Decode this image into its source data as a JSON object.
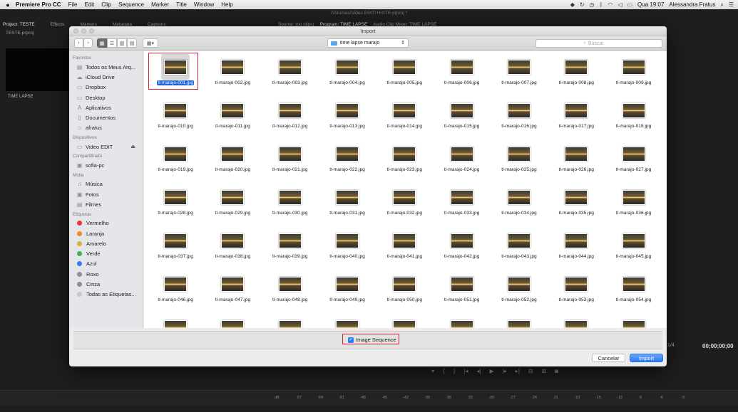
{
  "menubar": {
    "apple": "",
    "app_name": "Premiere Pro CC",
    "items": [
      "File",
      "Edit",
      "Clip",
      "Sequence",
      "Marker",
      "Title",
      "Window",
      "Help"
    ],
    "day_time": "Qua 19:07",
    "user": "Alessandra Fratus"
  },
  "premiere": {
    "path_title": "/Volumes/Video EDIT/TESTE.prproj *",
    "tabs_left": [
      "Project: TESTE",
      "Effects",
      "Markers",
      "Metadata",
      "Captions"
    ],
    "project_file": "TESTE.prproj",
    "clip_label": "TIME LAPSE",
    "source_tab": "Source: (no clips)",
    "program_tab": "Program: TIME LAPSE",
    "mixer_tab": "Audio Clip Mixer: TIME LAPSE",
    "timecode": "00;00;00;00",
    "timecode_left": "1/4",
    "ruler": [
      "-57",
      "-54",
      "-51",
      "-48",
      "-45",
      "-42",
      "-39",
      "-36",
      "-33",
      "-30",
      "-27",
      "-24",
      "-21",
      "-18",
      "-15",
      "-12",
      "-9",
      "-6",
      "-3",
      "dB"
    ]
  },
  "dialog": {
    "title": "Import",
    "location": "time lapse marajo",
    "search_placeholder": "Buscar",
    "sidebar": {
      "favorites_header": "Favoritos",
      "favorites": [
        "Todos os Meus Arq...",
        "iCloud Drive",
        "Dropbox",
        "Desktop",
        "Aplicativos",
        "Documentos",
        "afratus"
      ],
      "devices_header": "Dispositivos",
      "devices": [
        "Video EDIT"
      ],
      "shared_header": "Compartilhado",
      "shared": [
        "sofia-pc"
      ],
      "media_header": "Mídia",
      "media": [
        "Música",
        "Fotos",
        "Filmes"
      ],
      "tags_header": "Etiquetas",
      "tags": [
        {
          "label": "Vermelho",
          "color": "#f2343a"
        },
        {
          "label": "Laranja",
          "color": "#e8892b"
        },
        {
          "label": "Amarelo",
          "color": "#d7b13a"
        },
        {
          "label": "Verde",
          "color": "#3cb54a"
        },
        {
          "label": "Azul",
          "color": "#3478f6"
        },
        {
          "label": "Roxo",
          "color": "#9b87aa"
        },
        {
          "label": "Cinza",
          "color": "#8e8e93"
        },
        {
          "label": "Todas as Etiquetas...",
          "color": ""
        }
      ]
    },
    "files": [
      "tl-marajo-001.jpg",
      "tl-marajo-002.jpg",
      "tl-marajo-003.jpg",
      "tl-marajo-004.jpg",
      "tl-marajo-005.jpg",
      "tl-marajo-006.jpg",
      "tl-marajo-007.jpg",
      "tl-marajo-008.jpg",
      "tl-marajo-009.jpg",
      "tl-marajo-010.jpg",
      "tl-marajo-011.jpg",
      "tl-marajo-012.jpg",
      "tl-marajo-013.jpg",
      "tl-marajo-014.jpg",
      "tl-marajo-015.jpg",
      "tl-marajo-016.jpg",
      "tl-marajo-017.jpg",
      "tl-marajo-018.jpg",
      "tl-marajo-019.jpg",
      "tl-marajo-020.jpg",
      "tl-marajo-021.jpg",
      "tl-marajo-022.jpg",
      "tl-marajo-023.jpg",
      "tl-marajo-024.jpg",
      "tl-marajo-025.jpg",
      "tl-marajo-026.jpg",
      "tl-marajo-027.jpg",
      "tl-marajo-028.jpg",
      "tl-marajo-029.jpg",
      "tl-marajo-030.jpg",
      "tl-marajo-031.jpg",
      "tl-marajo-032.jpg",
      "tl-marajo-033.jpg",
      "tl-marajo-034.jpg",
      "tl-marajo-035.jpg",
      "tl-marajo-036.jpg",
      "tl-marajo-037.jpg",
      "tl-marajo-038.jpg",
      "tl-marajo-039.jpg",
      "tl-marajo-040.jpg",
      "tl-marajo-041.jpg",
      "tl-marajo-042.jpg",
      "tl-marajo-043.jpg",
      "tl-marajo-044.jpg",
      "tl-marajo-045.jpg",
      "tl-marajo-046.jpg",
      "tl-marajo-047.jpg",
      "tl-marajo-048.jpg",
      "tl-marajo-049.jpg",
      "tl-marajo-050.jpg",
      "tl-marajo-051.jpg",
      "tl-marajo-052.jpg",
      "tl-marajo-053.jpg",
      "tl-marajo-054.jpg",
      "",
      "",
      "",
      "",
      "",
      "",
      "",
      "",
      ""
    ],
    "selected_file": "tl-marajo-001.jpg",
    "image_sequence_label": "Image Sequence",
    "image_sequence_checked": true,
    "cancel_label": "Cancelar",
    "import_label": "Import"
  }
}
